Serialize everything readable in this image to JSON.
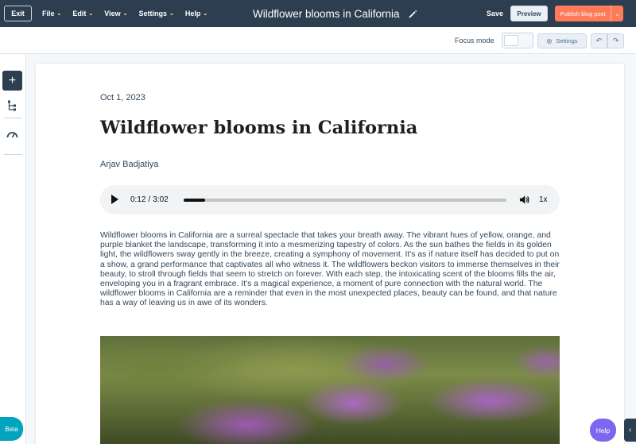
{
  "topbar": {
    "exit_label": "Exit",
    "menus": [
      "File",
      "Edit",
      "View",
      "Settings",
      "Help"
    ],
    "document_title": "Wildflower blooms in California",
    "save_label": "Save",
    "preview_label": "Preview",
    "publish_label": "Publish blog post"
  },
  "toolbar": {
    "focus_mode_label": "Focus mode",
    "settings_label": "Settings"
  },
  "post": {
    "date": "Oct 1, 2023",
    "title": "Wildflower blooms in California",
    "author": "Arjav Badjatiya",
    "body": "Wildflower blooms in California are a surreal spectacle that takes your breath away. The vibrant hues of yellow, orange, and purple blanket the landscape, transforming it into a mesmerizing tapestry of colors. As the sun bathes the fields in its golden light, the wildflowers sway gently in the breeze, creating a symphony of movement. It's as if nature itself has decided to put on a show, a grand performance that captivates all who witness it. The wildflowers beckon visitors to immerse themselves in their beauty, to stroll through fields that seem to stretch on forever. With each step, the intoxicating scent of the blooms fills the air, enveloping you in a fragrant embrace. It's a magical experience, a moment of pure connection with the natural world. The wildflower blooms in California are a reminder that even in the most unexpected places, beauty can be found, and that nature has a way of leaving us in awe of its wonders."
  },
  "audio": {
    "current_time": "0:12",
    "separator": "/",
    "duration": "3:02",
    "speed": "1x",
    "progress_fraction": 0.066
  },
  "floating": {
    "beta_label": "Beta",
    "help_label": "Help"
  },
  "colors": {
    "topbar_bg": "#2d3e50",
    "publish_accent": "#ff7a59",
    "help_accent": "#7b68ee",
    "beta_accent": "#00a4bd"
  }
}
